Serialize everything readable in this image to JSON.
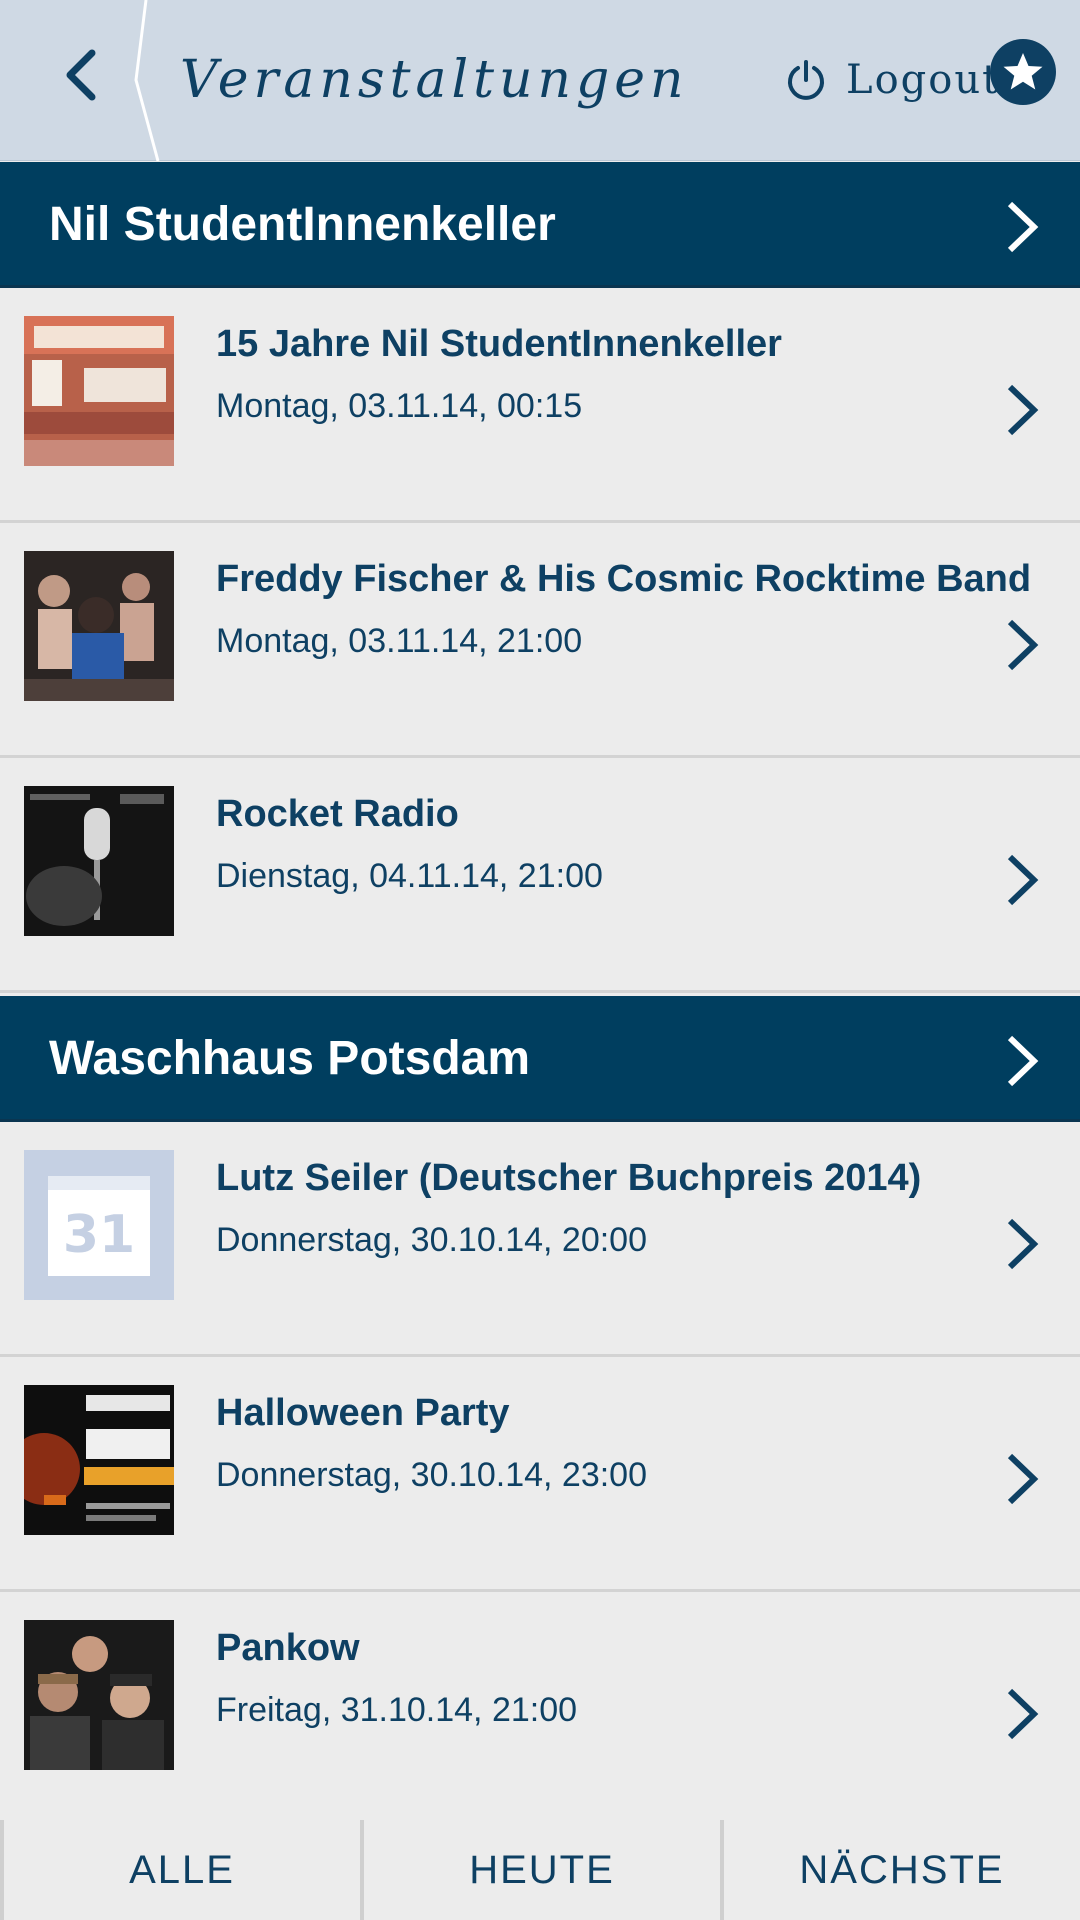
{
  "header": {
    "title": "Veranstaltungen",
    "logout_label": "Logout"
  },
  "sections": [
    {
      "title": "Nil StudentInnenkeller",
      "events": [
        {
          "title": "15 Jahre Nil StudentInnenkeller",
          "date": "Montag, 03.11.14, 00:15",
          "thumb": "poster-image"
        },
        {
          "title": "Freddy Fischer & His Cosmic Rocktime Band",
          "date": "Montag, 03.11.14, 21:00",
          "thumb": "band-photo"
        },
        {
          "title": "Rocket Radio",
          "date": "Dienstag, 04.11.14, 21:00",
          "thumb": "band-photo"
        }
      ]
    },
    {
      "title": "Waschhaus Potsdam",
      "events": [
        {
          "title": "Lutz Seiler (Deutscher Buchpreis 2014)",
          "date": "Donnerstag, 30.10.14, 20:00",
          "thumb": "calendar-icon"
        },
        {
          "title": "Halloween Party",
          "date": "Donnerstag, 30.10.14, 23:00",
          "thumb": "poster-image"
        },
        {
          "title": "Pankow",
          "date": "Freitag, 31.10.14, 21:00",
          "thumb": "band-photo"
        }
      ]
    }
  ],
  "tabs": [
    "ALLE",
    "HEUTE",
    "NÄCHSTE"
  ],
  "colors": {
    "header_bg": "#cfd9e4",
    "section_bg": "#003e5f",
    "text_primary": "#0e4063",
    "row_bg": "#ececec"
  }
}
